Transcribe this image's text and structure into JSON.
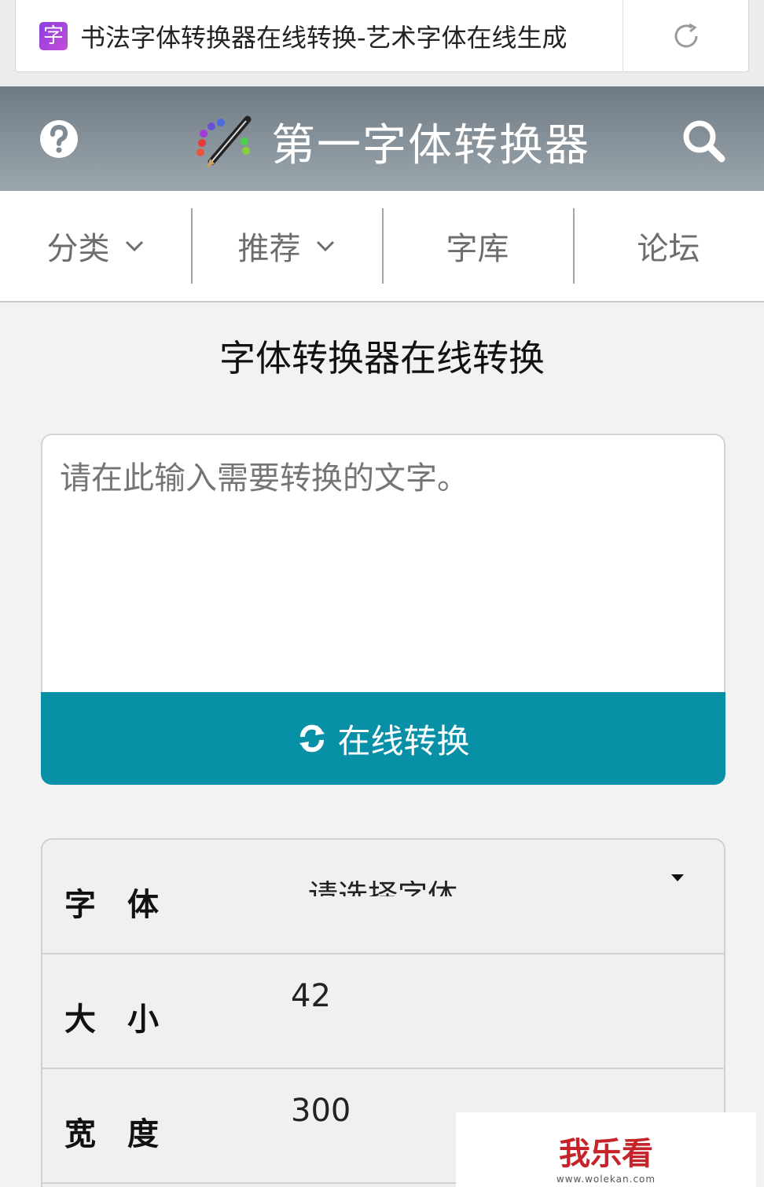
{
  "browser": {
    "favicon_char": "字",
    "tab_title": "书法字体转换器在线转换-艺术字体在线生成",
    "reload_icon": "reload-icon"
  },
  "header": {
    "title": "第一字体转换器",
    "help_icon": "question-circle-icon",
    "logo_icon": "pencil-logo-icon",
    "search_icon": "search-icon",
    "bg_color": "#7f8a93"
  },
  "nav": {
    "items": [
      {
        "label": "分类",
        "has_dropdown": true
      },
      {
        "label": "推荐",
        "has_dropdown": true
      },
      {
        "label": "字库",
        "has_dropdown": false
      },
      {
        "label": "论坛",
        "has_dropdown": false
      }
    ]
  },
  "main": {
    "heading": "字体转换器在线转换",
    "input_placeholder": "请在此输入需要转换的文字。",
    "input_value": "",
    "convert_label": "在线转换",
    "accent_color": "#0890a7"
  },
  "options": {
    "font": {
      "label": "字体",
      "value": "请选择字体"
    },
    "size": {
      "label": "大小",
      "value": "42"
    },
    "width": {
      "label": "宽度",
      "value": "300"
    }
  },
  "watermark": {
    "logo": "我乐看",
    "url": "www.wolekan.com"
  }
}
